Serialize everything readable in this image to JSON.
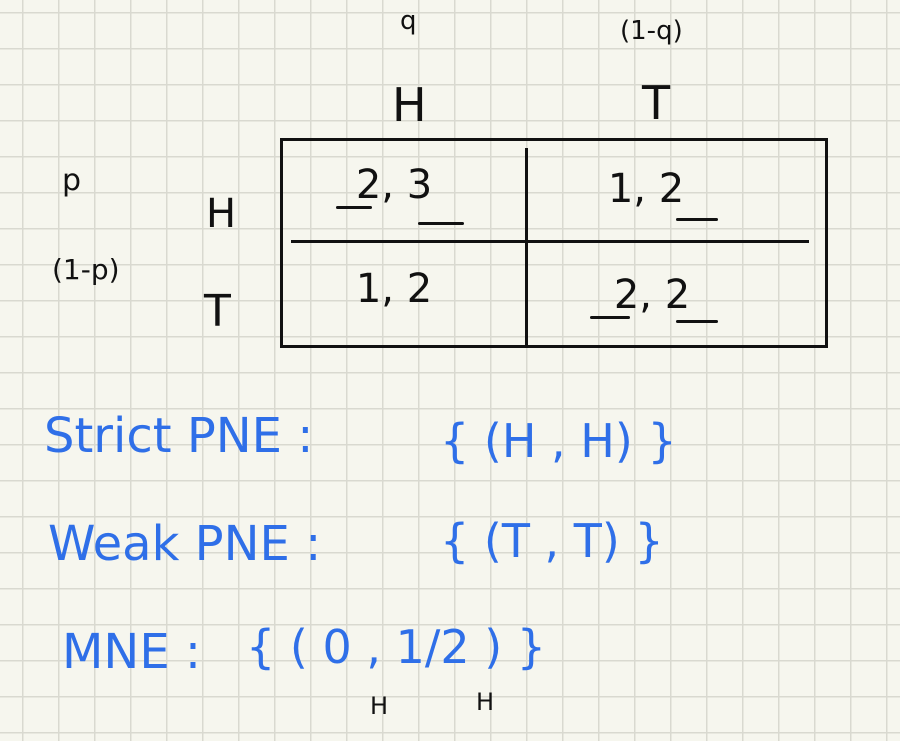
{
  "header": {
    "q_label": "q",
    "one_minus_q_label": "(1-q)",
    "col_h": "H",
    "col_t": "T"
  },
  "rows": {
    "p_label": "p",
    "one_minus_p_label": "(1-p)",
    "row_h": "H",
    "row_t": "T"
  },
  "payoffs": {
    "hh": "2, 3",
    "ht": "1, 2",
    "th": "1, 2",
    "tt": "2, 2"
  },
  "notes": {
    "strict_label": "Strict PNE :",
    "strict_value": "{ (H , H) }",
    "weak_label": "Weak PNE :",
    "weak_value": "{ (T , T) }",
    "mne_label": "MNE :",
    "mne_value": "{ ( 0 , 1/2 ) }",
    "mne_sub_1": "H",
    "mne_sub_2": "H"
  },
  "colors": {
    "ink": "#111111",
    "blue_ink": "#2f6fe8",
    "paper": "#f6f6ee",
    "grid": "#d9d9d0"
  }
}
